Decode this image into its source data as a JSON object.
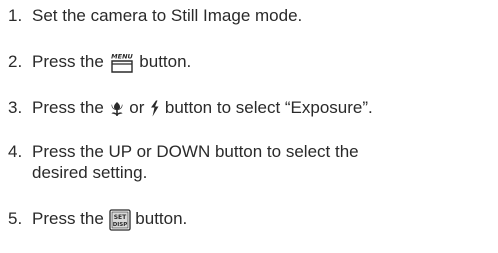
{
  "steps": [
    {
      "num": "1.",
      "text": "Set the camera to Still Image mode."
    },
    {
      "num": "2.",
      "before": "Press the",
      "icon_label": "MENU",
      "after": "button.",
      "icon": "menu-button-icon"
    },
    {
      "num": "3.",
      "before": "Press the",
      "mid": "or",
      "after": "button to select “Exposure”.",
      "icon1": "macro-tulip-icon",
      "icon2": "flash-bolt-icon"
    },
    {
      "num": "4.",
      "line1": "Press the UP or DOWN button to select the",
      "line2": "desired setting."
    },
    {
      "num": "5.",
      "before": "Press the",
      "icon_top": "SET",
      "icon_bottom": "DISP",
      "after": "button.",
      "icon": "set-disp-button-icon"
    }
  ]
}
